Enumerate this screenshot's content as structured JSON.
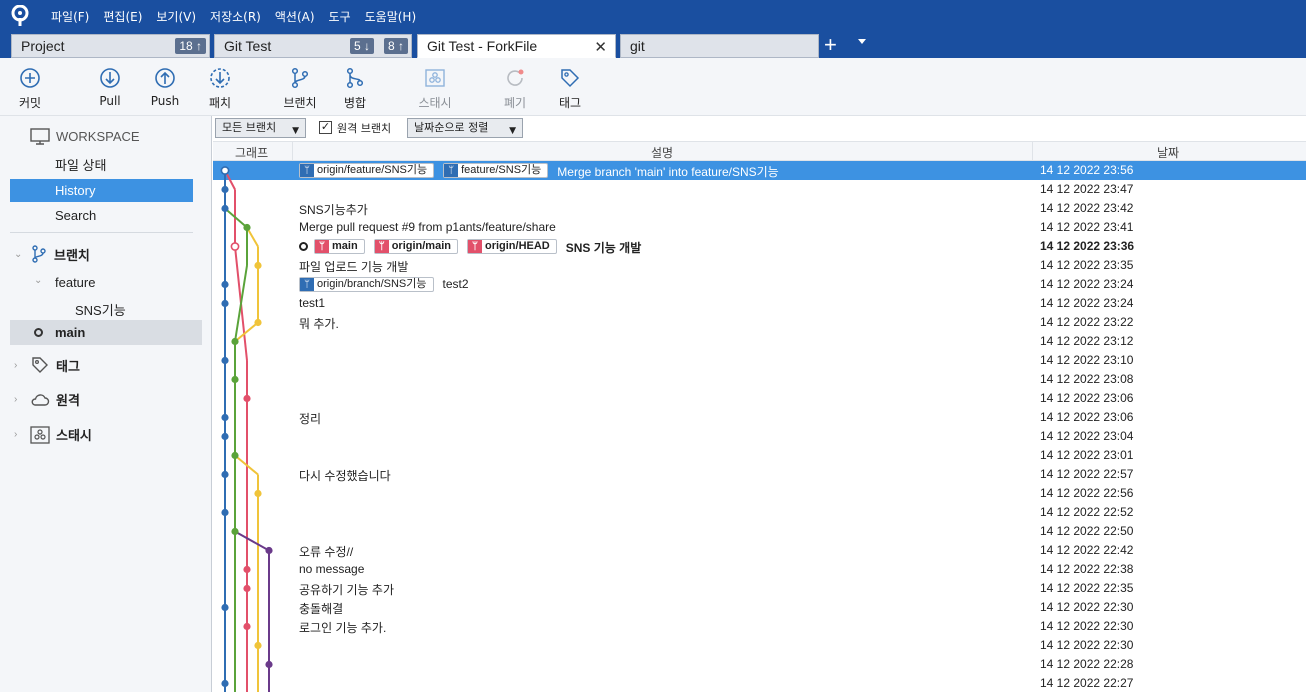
{
  "menu": [
    "파일(F)",
    "편집(E)",
    "보기(V)",
    "저장소(R)",
    "액션(A)",
    "도구",
    "도움말(H)"
  ],
  "tabs": [
    {
      "label": "Project",
      "badge": "18 ↑"
    },
    {
      "label": "Git Test",
      "badge_down": "5 ↓",
      "badge_up": "8 ↑"
    },
    {
      "label": "Git Test - ForkFile",
      "close": "✕"
    },
    {
      "label": "git"
    }
  ],
  "tab_add": "+",
  "toolbar": {
    "commit": "커밋",
    "pull": "Pull",
    "push": "Push",
    "patch": "패치",
    "branch": "브랜치",
    "merge": "병합",
    "stash": "스태시",
    "discard": "폐기",
    "tag": "태그"
  },
  "sidebar": {
    "workspace": "WORKSPACE",
    "file_status": "파일 상태",
    "history": "History",
    "search": "Search",
    "branches": "브랜치",
    "feature": "feature",
    "sns_branch": "SNS기능",
    "main": "main",
    "tags": "태그",
    "remotes": "원격",
    "stashes": "스태시"
  },
  "filters": {
    "branches": "모든 브랜치",
    "remote_label": "원격 브랜치",
    "remote_checked": "✓",
    "sort": "날짜순으로 정렬"
  },
  "columns": {
    "graph": "그래프",
    "description": "설명",
    "date": "날짜"
  },
  "commits": [
    {
      "refs": [
        {
          "label": "origin/feature/SNS기능",
          "color": "blue"
        },
        {
          "label": "feature/SNS기능",
          "color": "blue"
        }
      ],
      "message": "Merge branch 'main' into feature/SNS기능",
      "date": "14 12 2022 23:56"
    },
    {
      "refs": [],
      "message": "",
      "date": "14 12 2022 23:47"
    },
    {
      "refs": [],
      "message": "SNS기능추가",
      "date": "14 12 2022 23:42"
    },
    {
      "refs": [],
      "message": "Merge pull request #9 from p1ants/feature/share",
      "date": "14 12 2022 23:41"
    },
    {
      "head": true,
      "refs": [
        {
          "label": "main",
          "color": "red"
        },
        {
          "label": "origin/main",
          "color": "red"
        },
        {
          "label": "origin/HEAD",
          "color": "red"
        }
      ],
      "message": "SNS 기능 개발",
      "date": "14 12 2022 23:36"
    },
    {
      "refs": [],
      "message": "파일 업로드 기능 개발",
      "date": "14 12 2022 23:35"
    },
    {
      "refs": [
        {
          "label": "origin/branch/SNS기능",
          "color": "blue"
        }
      ],
      "message": "test2",
      "date": "14 12 2022 23:24"
    },
    {
      "refs": [],
      "message": "test1",
      "date": "14 12 2022 23:24"
    },
    {
      "refs": [],
      "message": "뭐 추가.",
      "date": "14 12 2022 23:22"
    },
    {
      "refs": [],
      "message": "",
      "date": "14 12 2022 23:12"
    },
    {
      "refs": [],
      "message": "",
      "date": "14 12 2022 23:10"
    },
    {
      "refs": [],
      "message": "",
      "date": "14 12 2022 23:08"
    },
    {
      "refs": [],
      "message": "",
      "date": "14 12 2022 23:06"
    },
    {
      "refs": [],
      "message": "정리",
      "date": "14 12 2022 23:06"
    },
    {
      "refs": [],
      "message": "",
      "date": "14 12 2022 23:04"
    },
    {
      "refs": [],
      "message": "",
      "date": "14 12 2022 23:01"
    },
    {
      "refs": [],
      "message": "다시 수정했습니다",
      "date": "14 12 2022 22:57"
    },
    {
      "refs": [],
      "message": "",
      "date": "14 12 2022 22:56"
    },
    {
      "refs": [],
      "message": "",
      "date": "14 12 2022 22:52"
    },
    {
      "refs": [],
      "message": "",
      "date": "14 12 2022 22:50"
    },
    {
      "refs": [],
      "message": "오류 수정//",
      "date": "14 12 2022 22:42"
    },
    {
      "refs": [],
      "message": "no message",
      "date": "14 12 2022 22:38"
    },
    {
      "refs": [],
      "message": "공유하기 기능 추가",
      "date": "14 12 2022 22:35"
    },
    {
      "refs": [],
      "message": "충돌해결",
      "date": "14 12 2022 22:30"
    },
    {
      "refs": [],
      "message": "로그인 기능 추가.",
      "date": "14 12 2022 22:30"
    },
    {
      "refs": [],
      "message": "",
      "date": "14 12 2022 22:30"
    },
    {
      "refs": [],
      "message": "",
      "date": "14 12 2022 22:28"
    },
    {
      "refs": [],
      "message": "",
      "date": "14 12 2022 22:27"
    }
  ],
  "graph_colors": {
    "blue": "#2f6db3",
    "pink": "#e2506a",
    "green": "#5aa33a",
    "yellow": "#f0c43a",
    "purple": "#6a3a8a"
  }
}
